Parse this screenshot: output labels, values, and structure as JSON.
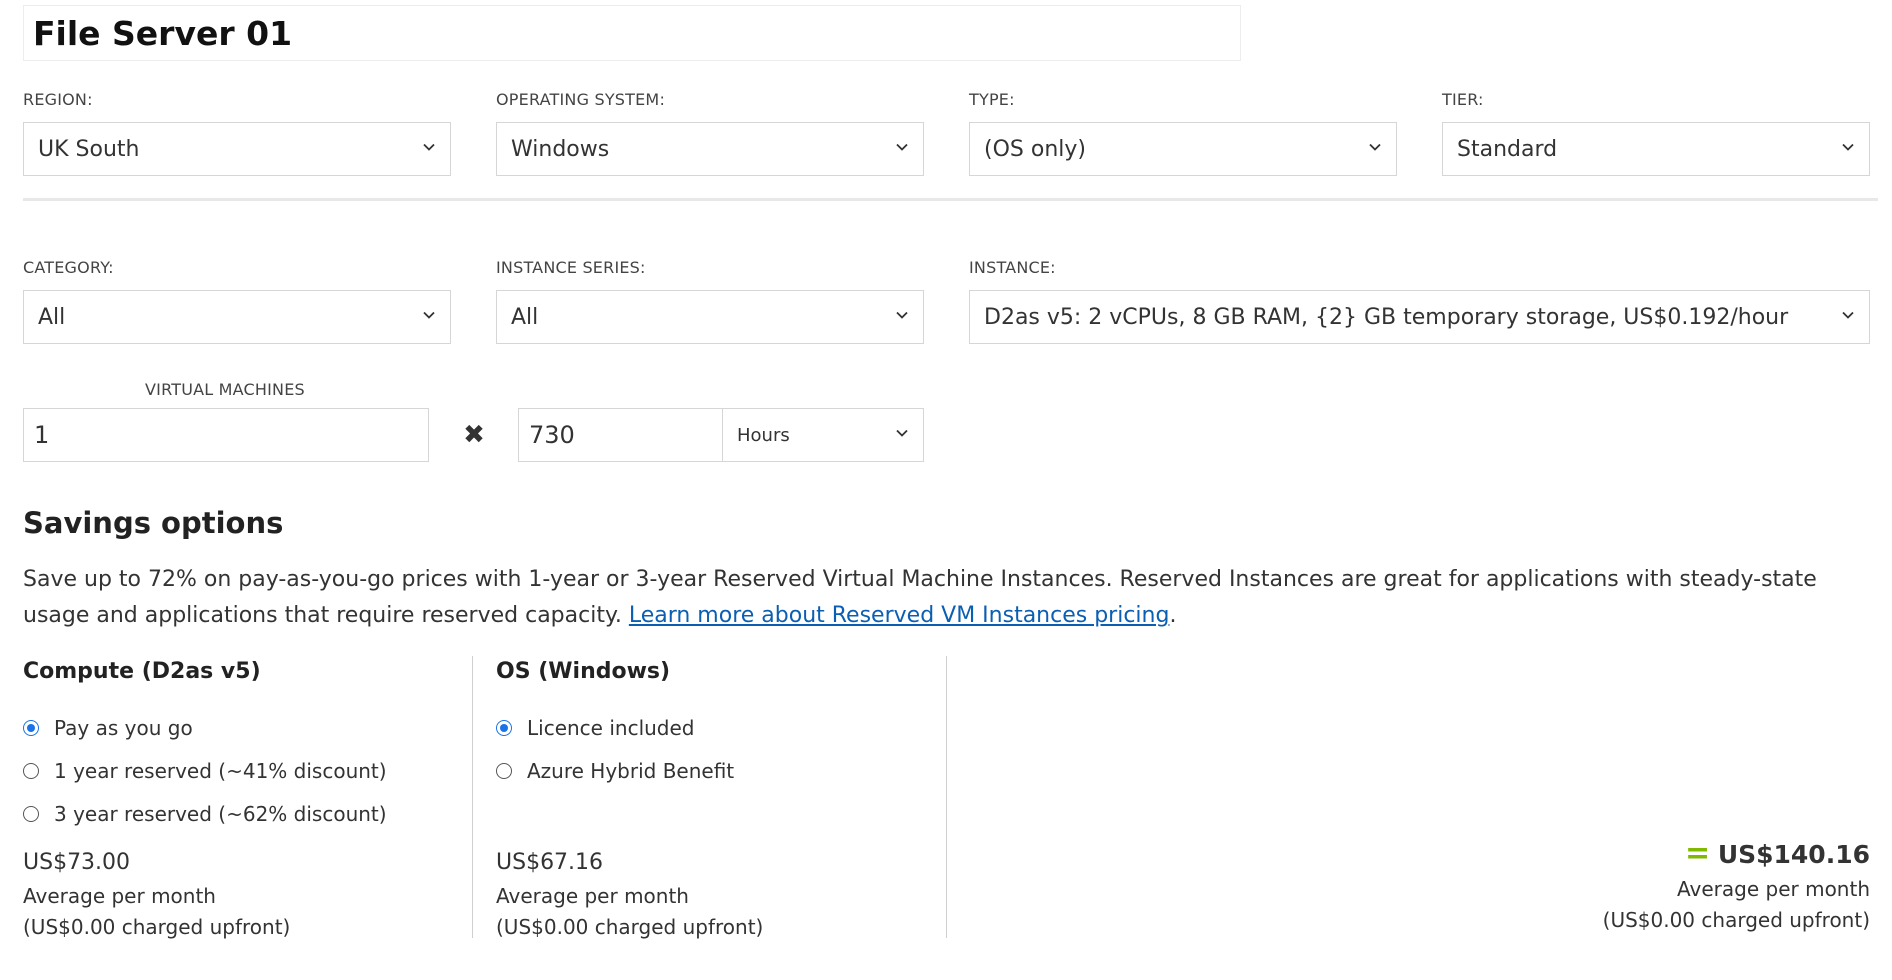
{
  "title": "File Server 01",
  "filters": {
    "region": {
      "label": "REGION:",
      "value": "UK South"
    },
    "os": {
      "label": "OPERATING SYSTEM:",
      "value": "Windows"
    },
    "type": {
      "label": "TYPE:",
      "value": "(OS only)"
    },
    "tier": {
      "label": "TIER:",
      "value": "Standard"
    },
    "category": {
      "label": "CATEGORY:",
      "value": "All"
    },
    "series": {
      "label": "INSTANCE SERIES:",
      "value": "All"
    },
    "instance": {
      "label": "INSTANCE:",
      "value": "D2as v5: 2 vCPUs, 8 GB RAM, {2} GB temporary storage, US$0.192/hour"
    }
  },
  "quantity": {
    "vm_label": "VIRTUAL MACHINES",
    "vm_value": "1",
    "times_symbol": "✖",
    "hours_value": "730",
    "unit": "Hours"
  },
  "savings": {
    "heading": "Savings options",
    "text": "Save up to 72% on pay-as-you-go prices with 1-year or 3-year Reserved Virtual Machine Instances. Reserved Instances are great for applications with steady-state usage and applications that require reserved capacity. ",
    "link": "Learn more about Reserved VM Instances pricing",
    "period": "."
  },
  "compute": {
    "heading": "Compute (D2as v5)",
    "options": [
      "Pay as you go",
      "1 year reserved (~41% discount)",
      "3 year reserved (~62% discount)"
    ],
    "selected": 0,
    "price": "US$73.00",
    "per": "Average per month",
    "upfront": "(US$0.00 charged upfront)"
  },
  "os_section": {
    "heading": "OS (Windows)",
    "options": [
      "Licence included",
      "Azure Hybrid Benefit"
    ],
    "selected": 0,
    "price": "US$67.16",
    "per": "Average per month",
    "upfront": "(US$0.00 charged upfront)"
  },
  "total": {
    "equals": "=",
    "price": "US$140.16",
    "per": "Average per month",
    "upfront": "(US$0.00 charged upfront)"
  },
  "colors": {
    "accent": "#1a73e8",
    "link": "#0b5fb3",
    "equals": "#7fba00"
  }
}
